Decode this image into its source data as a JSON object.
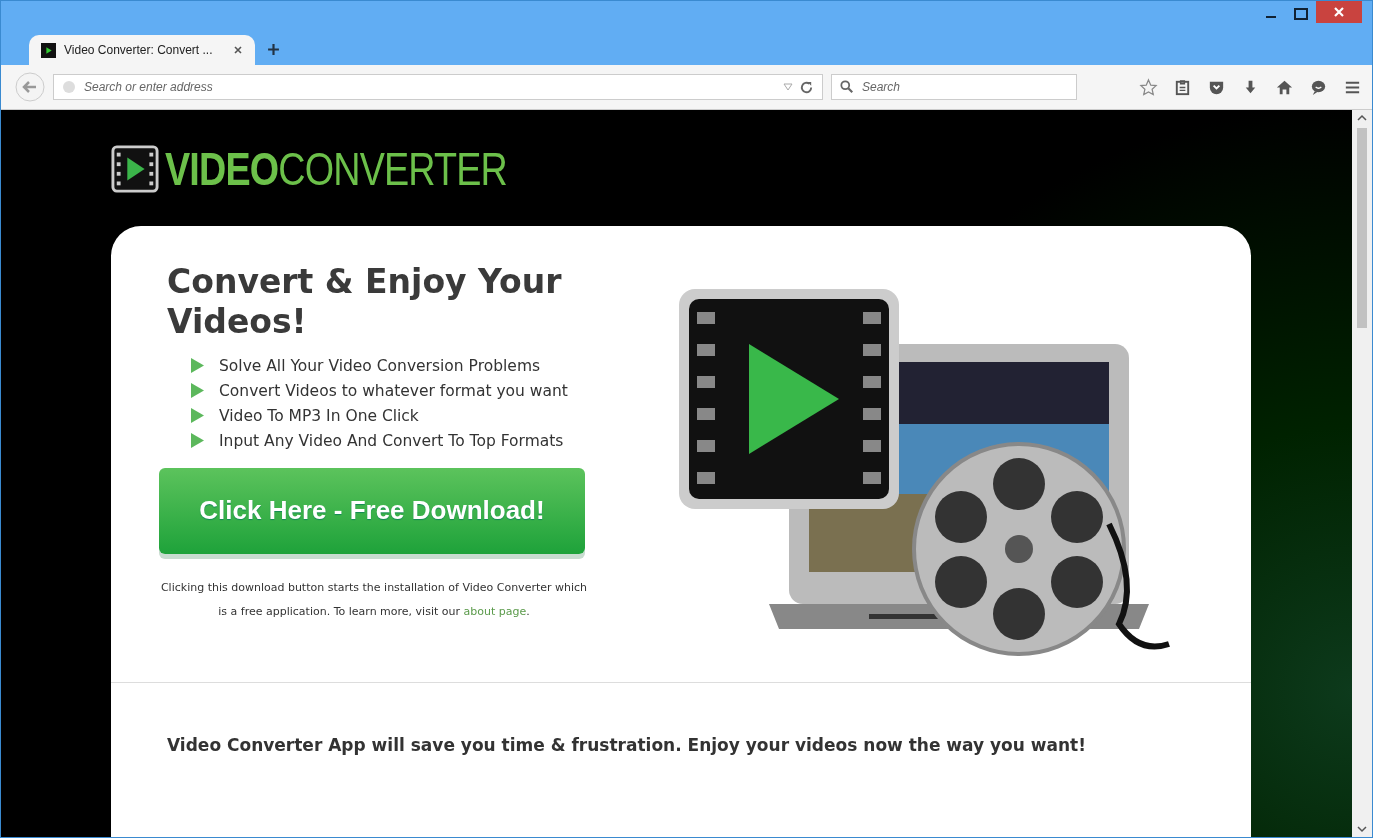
{
  "window": {
    "tabs": [
      {
        "title": "Video Converter: Convert ...",
        "selected": true
      }
    ]
  },
  "toolbar": {
    "address": {
      "placeholder": "Search or enter address"
    },
    "search": {
      "placeholder": "Search"
    }
  },
  "page": {
    "logo": {
      "strong": "VIDEO",
      "light": "CONVERTER"
    },
    "headline": "Convert & Enjoy Your Videos!",
    "features": [
      "Solve All Your Video Conversion Problems",
      "Convert Videos to whatever format you want",
      "Video To MP3 In One Click",
      "Input Any Video And Convert To Top Formats"
    ],
    "cta": "Click Here - Free Download!",
    "disclaimer": {
      "text": "Clicking this download button starts the installation of Video Converter which is a free application. To learn more, visit our ",
      "link": "about page",
      "end": "."
    },
    "tagline": "Video Converter App will save you time & frustration. Enjoy your videos now the way you want!"
  }
}
